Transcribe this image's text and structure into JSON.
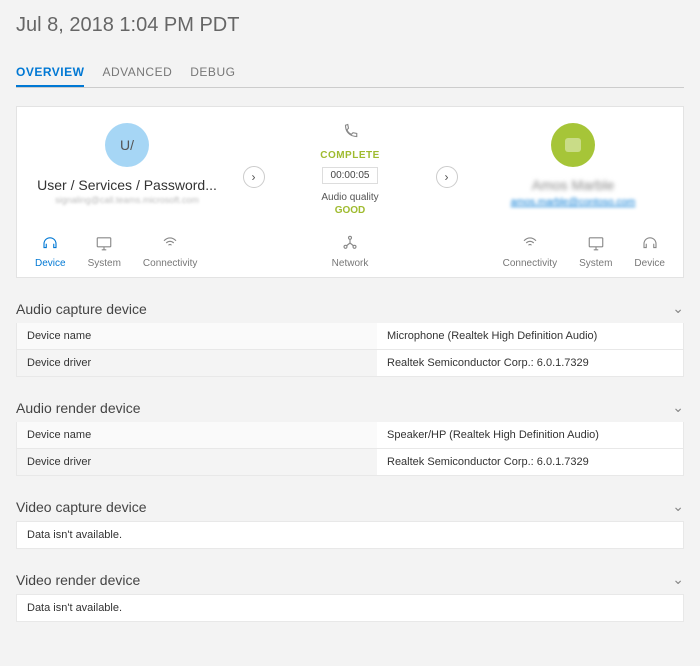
{
  "header": {
    "title": "Jul 8, 2018 1:04 PM PDT"
  },
  "tabs": {
    "overview": "OVERVIEW",
    "advanced": "ADVANCED",
    "debug": "DEBUG"
  },
  "parties": {
    "left": {
      "initials": "U/",
      "name": "User / Services / Password...",
      "sub": "signaling@call.teams.microsoft.com"
    },
    "center": {
      "status": "COMPLETE",
      "duration": "00:00:05",
      "aq_label": "Audio quality",
      "aq_value": "GOOD"
    },
    "right": {
      "name": "Amos Marble",
      "link": "amos.marble@contoso.com"
    }
  },
  "metrics": {
    "left": {
      "device": "Device",
      "system": "System",
      "connectivity": "Connectivity"
    },
    "center": {
      "network": "Network"
    },
    "right": {
      "connectivity": "Connectivity",
      "system": "System",
      "device": "Device"
    }
  },
  "sections": {
    "audio_capture": {
      "title": "Audio capture device",
      "rows": [
        {
          "label": "Device name",
          "value": "Microphone (Realtek High Definition Audio)"
        },
        {
          "label": "Device driver",
          "value": "Realtek Semiconductor Corp.: 6.0.1.7329"
        }
      ]
    },
    "audio_render": {
      "title": "Audio render device",
      "rows": [
        {
          "label": "Device name",
          "value": "Speaker/HP (Realtek High Definition Audio)"
        },
        {
          "label": "Device driver",
          "value": "Realtek Semiconductor Corp.: 6.0.1.7329"
        }
      ]
    },
    "video_capture": {
      "title": "Video capture device",
      "empty": "Data isn't available."
    },
    "video_render": {
      "title": "Video render device",
      "empty": "Data isn't available."
    }
  }
}
